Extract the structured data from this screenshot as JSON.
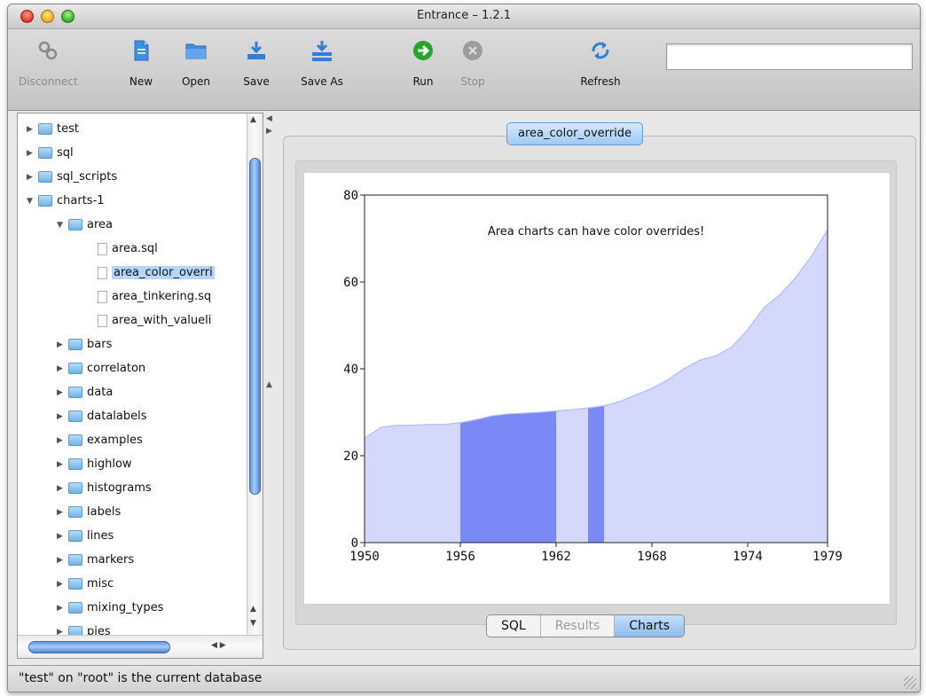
{
  "window": {
    "title": "Entrance – 1.2.1"
  },
  "toolbar": {
    "buttons": [
      {
        "label": "Disconnect",
        "icon": "disconnect-icon",
        "enabled": false
      },
      {
        "label": "New",
        "icon": "new-document-icon",
        "enabled": true
      },
      {
        "label": "Open",
        "icon": "folder-open-icon",
        "enabled": true
      },
      {
        "label": "Save",
        "icon": "save-icon",
        "enabled": true
      },
      {
        "label": "Save As",
        "icon": "save-as-icon",
        "enabled": true
      },
      {
        "label": "Run",
        "icon": "run-icon",
        "enabled": true
      },
      {
        "label": "Stop",
        "icon": "stop-icon",
        "enabled": false
      },
      {
        "label": "Refresh",
        "icon": "refresh-icon",
        "enabled": true
      }
    ],
    "search_value": ""
  },
  "tree": {
    "items": [
      {
        "label": "test",
        "type": "folder",
        "depth": 0,
        "expanded": false
      },
      {
        "label": "sql",
        "type": "folder",
        "depth": 0,
        "expanded": false
      },
      {
        "label": "sql_scripts",
        "type": "folder",
        "depth": 0,
        "expanded": false
      },
      {
        "label": "charts-1",
        "type": "folder",
        "depth": 0,
        "expanded": true
      },
      {
        "label": "area",
        "type": "folder",
        "depth": 1,
        "expanded": true
      },
      {
        "label": "area.sql",
        "type": "file",
        "depth": 2
      },
      {
        "label": "area_color_overri",
        "type": "file",
        "depth": 2,
        "selected": true
      },
      {
        "label": "area_tinkering.sq",
        "type": "file",
        "depth": 2
      },
      {
        "label": "area_with_valueli",
        "type": "file",
        "depth": 2
      },
      {
        "label": "bars",
        "type": "folder",
        "depth": 1,
        "expanded": false
      },
      {
        "label": "correlaton",
        "type": "folder",
        "depth": 1,
        "expanded": false
      },
      {
        "label": "data",
        "type": "folder",
        "depth": 1,
        "expanded": false
      },
      {
        "label": "datalabels",
        "type": "folder",
        "depth": 1,
        "expanded": false
      },
      {
        "label": "examples",
        "type": "folder",
        "depth": 1,
        "expanded": false
      },
      {
        "label": "highlow",
        "type": "folder",
        "depth": 1,
        "expanded": false
      },
      {
        "label": "histograms",
        "type": "folder",
        "depth": 1,
        "expanded": false
      },
      {
        "label": "labels",
        "type": "folder",
        "depth": 1,
        "expanded": false
      },
      {
        "label": "lines",
        "type": "folder",
        "depth": 1,
        "expanded": false
      },
      {
        "label": "markers",
        "type": "folder",
        "depth": 1,
        "expanded": false
      },
      {
        "label": "misc",
        "type": "folder",
        "depth": 1,
        "expanded": false
      },
      {
        "label": "mixing_types",
        "type": "folder",
        "depth": 1,
        "expanded": false
      },
      {
        "label": "pies",
        "type": "folder",
        "depth": 1,
        "expanded": false
      }
    ]
  },
  "main": {
    "tab_title": "area_color_override",
    "view_tabs": [
      {
        "label": "SQL",
        "state": "normal"
      },
      {
        "label": "Results",
        "state": "disabled"
      },
      {
        "label": "Charts",
        "state": "active"
      }
    ]
  },
  "status": {
    "text": "\"test\" on \"root\" is the current database"
  },
  "chart_data": {
    "type": "area",
    "title": "Area charts can have color overrides!",
    "xlabel": "",
    "ylabel": "",
    "xlim": [
      1950,
      1979
    ],
    "ylim": [
      0,
      80
    ],
    "x_ticks": [
      1950,
      1956,
      1962,
      1968,
      1974,
      1979
    ],
    "y_ticks": [
      0,
      20,
      40,
      60,
      80
    ],
    "grid": false,
    "legend": "none",
    "fill_color": "#d4d8fb",
    "line_color": "#b3baf3",
    "override_color": "#7b89f7",
    "overrides": [
      {
        "from": 1956,
        "to": 1962
      },
      {
        "from": 1964,
        "to": 1965
      }
    ],
    "x": [
      1950,
      1951,
      1952,
      1953,
      1954,
      1955,
      1956,
      1957,
      1958,
      1959,
      1960,
      1961,
      1962,
      1963,
      1964,
      1965,
      1966,
      1967,
      1968,
      1969,
      1970,
      1971,
      1972,
      1973,
      1974,
      1975,
      1976,
      1977,
      1978,
      1979
    ],
    "values": [
      24,
      26.5,
      27,
      27,
      27.2,
      27.2,
      27.6,
      28.3,
      29.2,
      29.6,
      29.8,
      30,
      30.3,
      30.6,
      31,
      31.5,
      32.5,
      34,
      35.5,
      37.5,
      40,
      42,
      43,
      45,
      49,
      54,
      57,
      61,
      66,
      72
    ]
  }
}
